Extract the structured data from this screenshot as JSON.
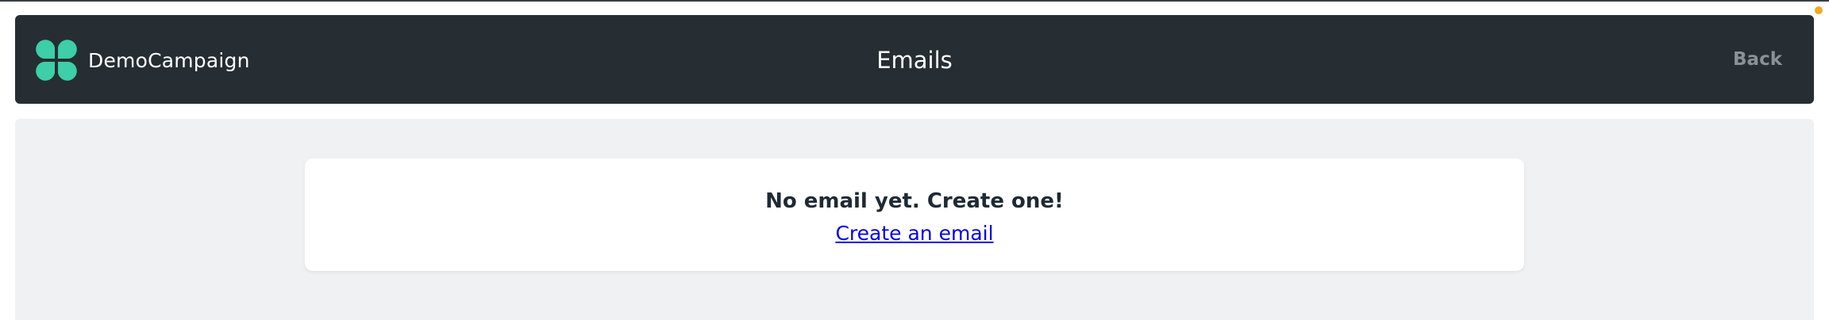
{
  "header": {
    "brand_name": "DemoCampaign",
    "logo_icon": "clover-logo-icon",
    "title": "Emails",
    "back_label": "Back"
  },
  "empty_state": {
    "message": "No email yet. Create one!",
    "create_link": "Create an email"
  },
  "colors": {
    "header_bg": "#262e33",
    "logo": "#3ccfa8",
    "content_bg": "#f0f1f2",
    "link": "#0000ee",
    "notification": "#f5a623"
  }
}
